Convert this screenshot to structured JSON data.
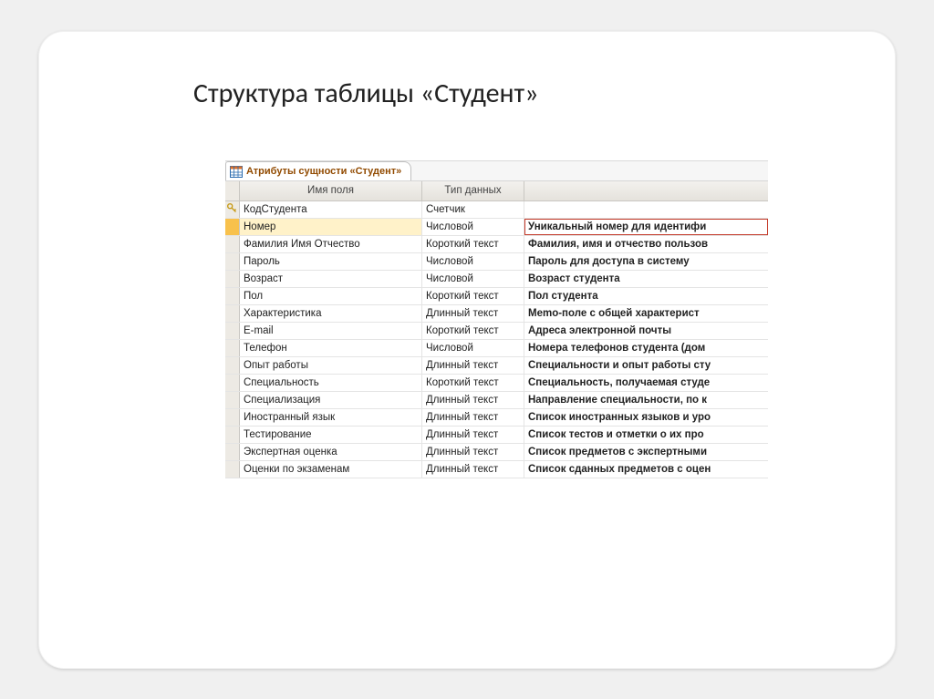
{
  "slide": {
    "title": "Структура таблицы «Студент»"
  },
  "tab": {
    "label": "Атрибуты сущности «Студент»"
  },
  "headers": {
    "name": "Имя поля",
    "type": "Тип данных",
    "desc": ""
  },
  "rows": [
    {
      "key": true,
      "active": false,
      "name": "КодСтудента",
      "type": "Счетчик",
      "desc": ""
    },
    {
      "key": false,
      "active": true,
      "name": "Номер",
      "type": "Числовой",
      "desc": "Уникальный номер для идентифи"
    },
    {
      "key": false,
      "active": false,
      "name": "Фамилия Имя Отчество",
      "type": "Короткий текст",
      "desc": "Фамилия, имя и отчество пользов"
    },
    {
      "key": false,
      "active": false,
      "name": "Пароль",
      "type": "Числовой",
      "desc": "Пароль для доступа в систему"
    },
    {
      "key": false,
      "active": false,
      "name": "Возраст",
      "type": "Числовой",
      "desc": "Возраст студента"
    },
    {
      "key": false,
      "active": false,
      "name": "Пол",
      "type": "Короткий текст",
      "desc": "Пол студента"
    },
    {
      "key": false,
      "active": false,
      "name": "Характеристика",
      "type": "Длинный текст",
      "desc": "Memo-поле с общей характерист"
    },
    {
      "key": false,
      "active": false,
      "name": "E-mail",
      "type": "Короткий текст",
      "desc": "Адреса электронной почты"
    },
    {
      "key": false,
      "active": false,
      "name": "Телефон",
      "type": "Числовой",
      "desc": "Номера телефонов студента (дом"
    },
    {
      "key": false,
      "active": false,
      "name": "Опыт работы",
      "type": "Длинный текст",
      "desc": "Специальности и опыт работы сту"
    },
    {
      "key": false,
      "active": false,
      "name": "Специальность",
      "type": "Короткий текст",
      "desc": "Специальность, получаемая студе"
    },
    {
      "key": false,
      "active": false,
      "name": "Специализация",
      "type": "Длинный текст",
      "desc": "Направление специальности, по к"
    },
    {
      "key": false,
      "active": false,
      "name": "Иностранный язык",
      "type": "Длинный текст",
      "desc": "Список иностранных языков и уро"
    },
    {
      "key": false,
      "active": false,
      "name": "Тестирование",
      "type": "Длинный текст",
      "desc": "Список тестов и отметки о их про"
    },
    {
      "key": false,
      "active": false,
      "name": "Экспертная оценка",
      "type": "Длинный текст",
      "desc": "Список предметов с экспертными"
    },
    {
      "key": false,
      "active": false,
      "name": "Оценки по экзаменам",
      "type": "Длинный текст",
      "desc": "Список сданных предметов с оцен"
    }
  ]
}
